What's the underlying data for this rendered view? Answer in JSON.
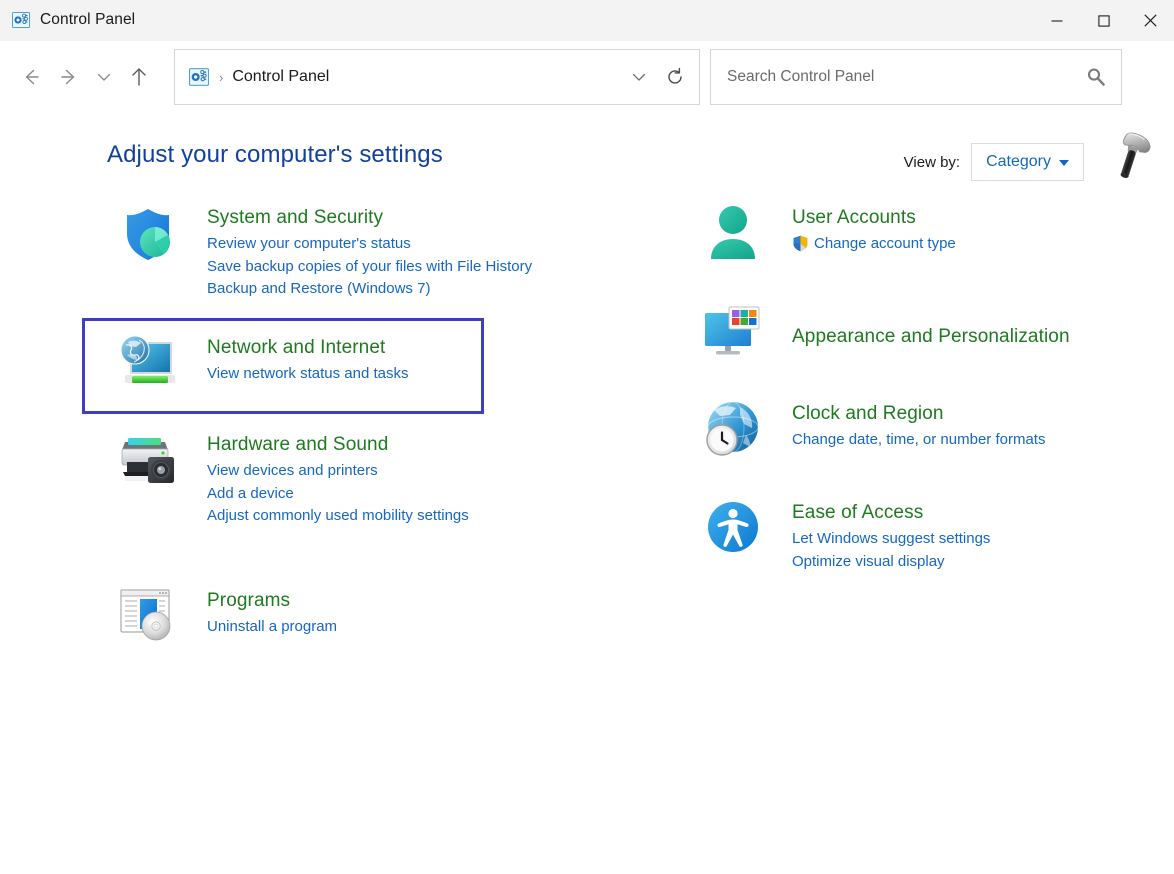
{
  "window": {
    "title": "Control Panel",
    "app_icon": "control-panel-icon",
    "controls": {
      "minimize": "Minimize",
      "maximize": "Maximize",
      "close": "Close"
    }
  },
  "toolbar": {
    "back": "Back",
    "forward": "Forward",
    "recent": "Recent locations",
    "up": "Up",
    "address": {
      "icon": "control-panel-icon",
      "separator": "›",
      "crumb": "Control Panel",
      "dropdown": "Previous locations",
      "refresh": "Refresh"
    },
    "search": {
      "placeholder": "Search Control Panel",
      "value": "",
      "icon": "search-icon"
    }
  },
  "page": {
    "title": "Adjust your computer's settings",
    "view_by_label": "View by:",
    "view_by_value": "Category",
    "cursor_icon": "hammer-icon"
  },
  "colors": {
    "heading": "#12409f",
    "category_title": "#1f7a1f",
    "link": "#1567c2",
    "highlight_border": "#3d3ec4",
    "titlebar_bg": "#f3f3f3"
  },
  "categories": {
    "left": [
      {
        "id": "system-and-security",
        "icon": "shield-icon",
        "title": "System and Security",
        "highlighted": false,
        "links": [
          "Review your computer's status",
          "Save backup copies of your files with File History",
          "Backup and Restore (Windows 7)"
        ]
      },
      {
        "id": "network-and-internet",
        "icon": "network-globe-monitor-icon",
        "title": "Network and Internet",
        "highlighted": true,
        "links": [
          "View network status and tasks"
        ]
      },
      {
        "id": "hardware-and-sound",
        "icon": "printer-speaker-icon",
        "title": "Hardware and Sound",
        "highlighted": false,
        "links": [
          "View devices and printers",
          "Add a device",
          "Adjust commonly used mobility settings"
        ]
      },
      {
        "id": "programs",
        "icon": "programs-disc-icon",
        "title": "Programs",
        "highlighted": false,
        "links": [
          "Uninstall a program"
        ]
      }
    ],
    "right": [
      {
        "id": "user-accounts",
        "icon": "user-person-icon",
        "title": "User Accounts",
        "highlighted": false,
        "links": [
          "Change account type"
        ],
        "link_shields": [
          true
        ]
      },
      {
        "id": "appearance-and-personalization",
        "icon": "monitor-colors-icon",
        "title": "Appearance and Personalization",
        "highlighted": false,
        "links": []
      },
      {
        "id": "clock-and-region",
        "icon": "globe-clock-icon",
        "title": "Clock and Region",
        "highlighted": false,
        "links": [
          "Change date, time, or number formats"
        ]
      },
      {
        "id": "ease-of-access",
        "icon": "accessibility-icon",
        "title": "Ease of Access",
        "highlighted": false,
        "links": [
          "Let Windows suggest settings",
          "Optimize visual display"
        ]
      }
    ]
  }
}
